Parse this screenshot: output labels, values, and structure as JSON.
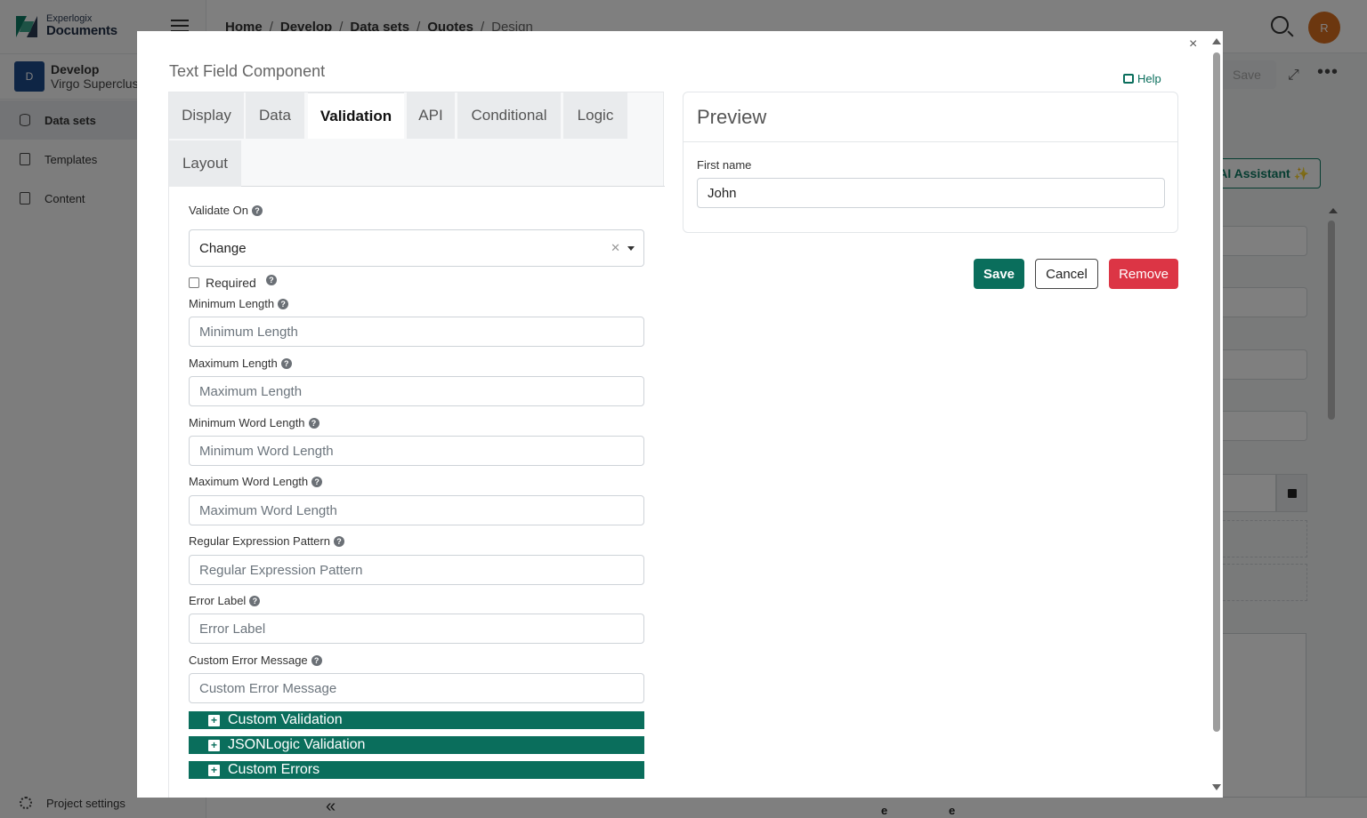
{
  "app": {
    "logo_small": "Experlogix",
    "logo_big": "Documents",
    "project_badge": "D",
    "project_name": "Develop",
    "project_sub": "Virgo Supercluster",
    "nav": [
      {
        "label": "Data sets",
        "active": true
      },
      {
        "label": "Templates"
      },
      {
        "label": "Content"
      }
    ],
    "settings_label": "Project settings",
    "breadcrumb": [
      "Home",
      "Develop",
      "Data sets",
      "Quotes",
      "Design"
    ],
    "avatar_initial": "R",
    "save_label": "Save",
    "assistant_label": "AI Assistant ✨",
    "bottom_letters": [
      "e",
      "e"
    ]
  },
  "modal": {
    "title": "Text Field Component",
    "close_glyph": "×",
    "help_label": "Help",
    "tabs": [
      {
        "label": "Display"
      },
      {
        "label": "Data"
      },
      {
        "label": "Validation",
        "active": true
      },
      {
        "label": "API"
      },
      {
        "label": "Conditional"
      },
      {
        "label": "Logic"
      },
      {
        "label": "Layout"
      }
    ],
    "validate_on": {
      "label": "Validate On",
      "value": "Change"
    },
    "required_label": "Required",
    "fields": [
      {
        "label": "Minimum Length",
        "placeholder": "Minimum Length"
      },
      {
        "label": "Maximum Length",
        "placeholder": "Maximum Length"
      },
      {
        "label": "Minimum Word Length",
        "placeholder": "Minimum Word Length"
      },
      {
        "label": "Maximum Word Length",
        "placeholder": "Maximum Word Length"
      },
      {
        "label": "Regular Expression Pattern",
        "placeholder": "Regular Expression Pattern"
      },
      {
        "label": "Error Label",
        "placeholder": "Error Label"
      },
      {
        "label": "Custom Error Message",
        "placeholder": "Custom Error Message"
      }
    ],
    "accordions": [
      "Custom Validation",
      "JSONLogic Validation",
      "Custom Errors"
    ],
    "preview": {
      "title": "Preview",
      "field_label": "First name",
      "field_value": "John"
    },
    "buttons": {
      "save": "Save",
      "cancel": "Cancel",
      "remove": "Remove"
    }
  },
  "colors": {
    "brand": "#0a6e5c",
    "danger": "#dc3545",
    "avatar": "#d96e1f"
  }
}
